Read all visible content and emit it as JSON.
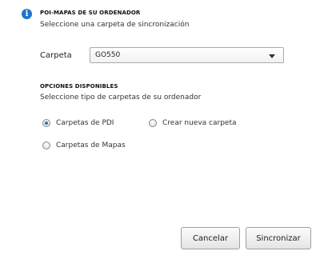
{
  "header": {
    "title": "POI-MAPAS DE SU ORDENADOR",
    "subtitle": "Seleccione una carpeta de sincronización"
  },
  "folder": {
    "label": "Carpeta",
    "selected": "GO550"
  },
  "options": {
    "title": "OPCIONES DISPONIBLES",
    "subtitle": "Seleccione tipo de carpetas de su ordenador",
    "items": [
      {
        "label": "Carpetas de PDI",
        "checked": true
      },
      {
        "label": "Crear nueva carpeta",
        "checked": false
      },
      {
        "label": "Carpetas de Mapas",
        "checked": false
      }
    ]
  },
  "buttons": {
    "cancel": "Cancelar",
    "sync": "Sincronizar"
  },
  "colors": {
    "accent": "#1f76c8"
  },
  "icons": {
    "info": "info-icon",
    "dropdown": "chevron-down-icon"
  }
}
